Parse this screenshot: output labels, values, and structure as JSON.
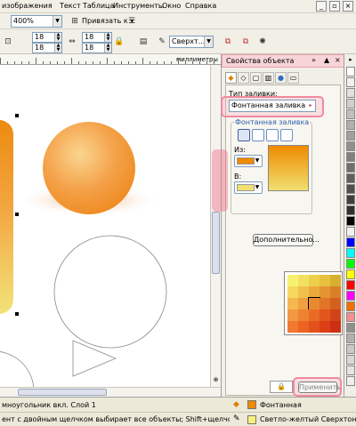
{
  "menubar": {
    "items": [
      "изображения",
      "Текст",
      "Таблица",
      "Инструменты",
      "Окно",
      "Справка"
    ],
    "window_buttons": [
      "_",
      "▫",
      "×"
    ]
  },
  "toolbar1": {
    "zoom_value": "400%",
    "snap_label": "Привязать к"
  },
  "toolbar2": {
    "spin1": "18",
    "spin2": "18",
    "spin3": "18",
    "spin4": "18",
    "font_combo": "Сверхт..."
  },
  "ruler": {
    "unit_label": "миллиметры"
  },
  "docker": {
    "title": "Свойства объекта",
    "fill_type_label": "Тип заливки:",
    "fill_type_value": "Фонтанная заливка",
    "group_label": "Фонтанная заливка",
    "from_label": "Из:",
    "to_label": "В:",
    "more_button": "Дополнительно...",
    "apply_button": "Применить",
    "colors": {
      "from": "#f08a00",
      "to": "#f0e070",
      "accent": "#f08aa0"
    }
  },
  "status": {
    "line1_left": "мноугольник вкл. Слой 1",
    "line1_fill": "Фонтанная",
    "line2_left": "ент с двойным щелчком выбирает все объекты; Shift+щелчок - выбор не...",
    "line2_fill": "Светло-желтый  Сверхтонкий"
  }
}
